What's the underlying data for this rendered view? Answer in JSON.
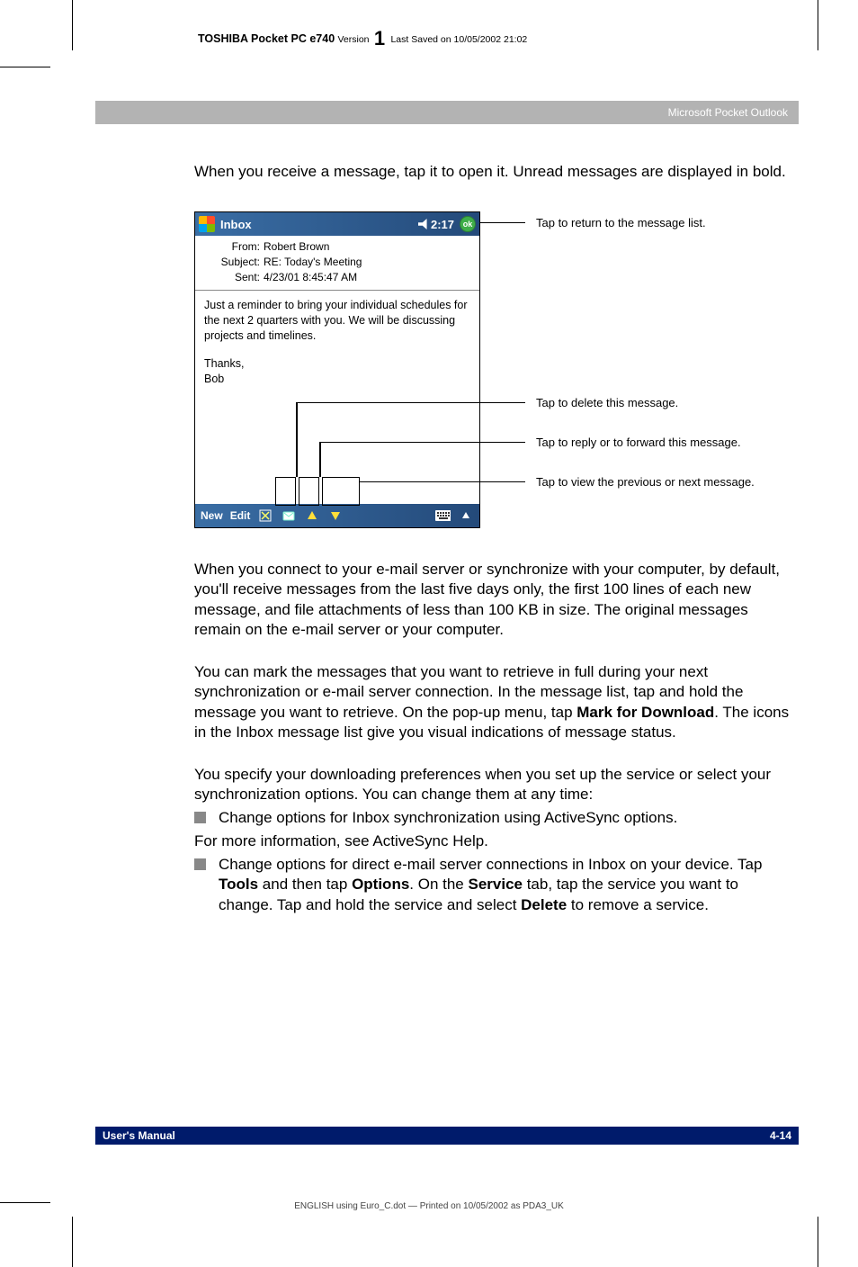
{
  "header": {
    "product": "TOSHIBA Pocket PC e740",
    "version_label": "Version",
    "version_num": "1",
    "saved": "Last Saved on 10/05/2002 21:02"
  },
  "section_title": "Microsoft Pocket Outlook",
  "intro": "When you receive a message, tap it to open it. Unread messages are displayed in bold.",
  "screen": {
    "title": "Inbox",
    "time": "2:17",
    "ok": "ok",
    "from_label": "From:",
    "from_value": "Robert Brown",
    "subject_label": "Subject:",
    "subject_value": "RE: Today's Meeting",
    "sent_label": "Sent:",
    "sent_value": "4/23/01 8:45:47 AM",
    "body_p1": "Just a reminder to bring your individual schedules for the next 2 quarters with you. We will be discussing projects and timelines.",
    "body_p2": "Thanks,",
    "body_p3": "Bob",
    "cmd_new": "New",
    "cmd_edit": "Edit"
  },
  "callouts": {
    "c1": "Tap to return to the message list.",
    "c2": "Tap to delete this message.",
    "c3": "Tap to reply or to forward this message.",
    "c4": "Tap to view the previous or next message."
  },
  "para1": "When you connect to your e-mail server or synchronize with your computer, by default, you'll receive messages from the last five days only, the first 100 lines of each new message, and file attachments of less than 100 KB in size. The original messages remain on the e-mail server or your computer.",
  "para2_a": "You can mark the messages that you want to retrieve in full during your next synchronization or e-mail server connection. In the message list, tap and hold the message you want to retrieve. On the pop-up menu, tap ",
  "para2_b": "Mark for Download",
  "para2_c": ". The icons in the Inbox message list give you visual indications of message status.",
  "para3": "You specify your downloading preferences when you set up the service or select your synchronization options. You can change them at any time:",
  "bullet1": "Change options for Inbox synchronization using ActiveSync options.",
  "para4": "For more information, see ActiveSync Help.",
  "bullet2_a": "Change options for direct e-mail server connections in Inbox on your device. Tap ",
  "bullet2_b": "Tools",
  "bullet2_c": " and then tap ",
  "bullet2_d": "Options",
  "bullet2_e": ". On the ",
  "bullet2_f": "Service",
  "bullet2_g": " tab, tap the service you want to change. Tap and hold the service and select ",
  "bullet2_h": "Delete",
  "bullet2_i": " to remove a service.",
  "footer": {
    "left": "User's Manual",
    "right": "4-14"
  },
  "print_line": "ENGLISH using  Euro_C.dot — Printed on 10/05/2002 as PDA3_UK"
}
